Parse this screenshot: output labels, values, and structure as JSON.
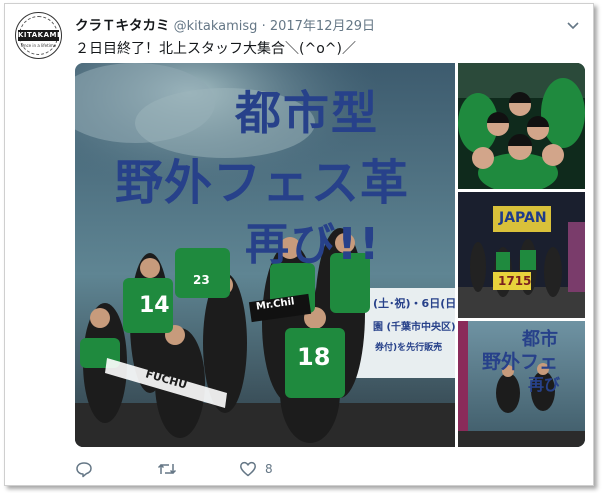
{
  "tweet": {
    "display_name": "クラＴキタカミ",
    "handle": "@kitakamisg",
    "separator": "·",
    "date": "2017年12月29日",
    "text": "２日目終了！北上スタッフ大集合＼(^o^)／"
  },
  "avatar": {
    "label": "KITAKAMI",
    "sub": "Once in a lifetime"
  },
  "main_photo": {
    "banner_line1": "都市型",
    "banner_line2": "野外フェス革",
    "banner_line3": "再び!!",
    "date_fragment": "(土･祝)・6日(日",
    "venue_fragment": "園 (千葉市中央区)",
    "sale_fragment": "券付)を先行販売",
    "jersey_number_a": "14",
    "jersey_number_b": "18",
    "jersey_number_c": "23",
    "scarf_text": "FUCHU",
    "sign_text": "Mr.Chil"
  },
  "side_photo_2": {
    "sign_top": "JAPAN",
    "sign_bottom": "1715"
  },
  "side_photo_3": {
    "line1": "都市",
    "line2": "野外フェ",
    "line3": "再び"
  },
  "actions": {
    "like_count": "8"
  },
  "colors": {
    "accent_green": "#1f8a3e",
    "text_gray": "#657786",
    "banner_blue": "#27418a"
  }
}
